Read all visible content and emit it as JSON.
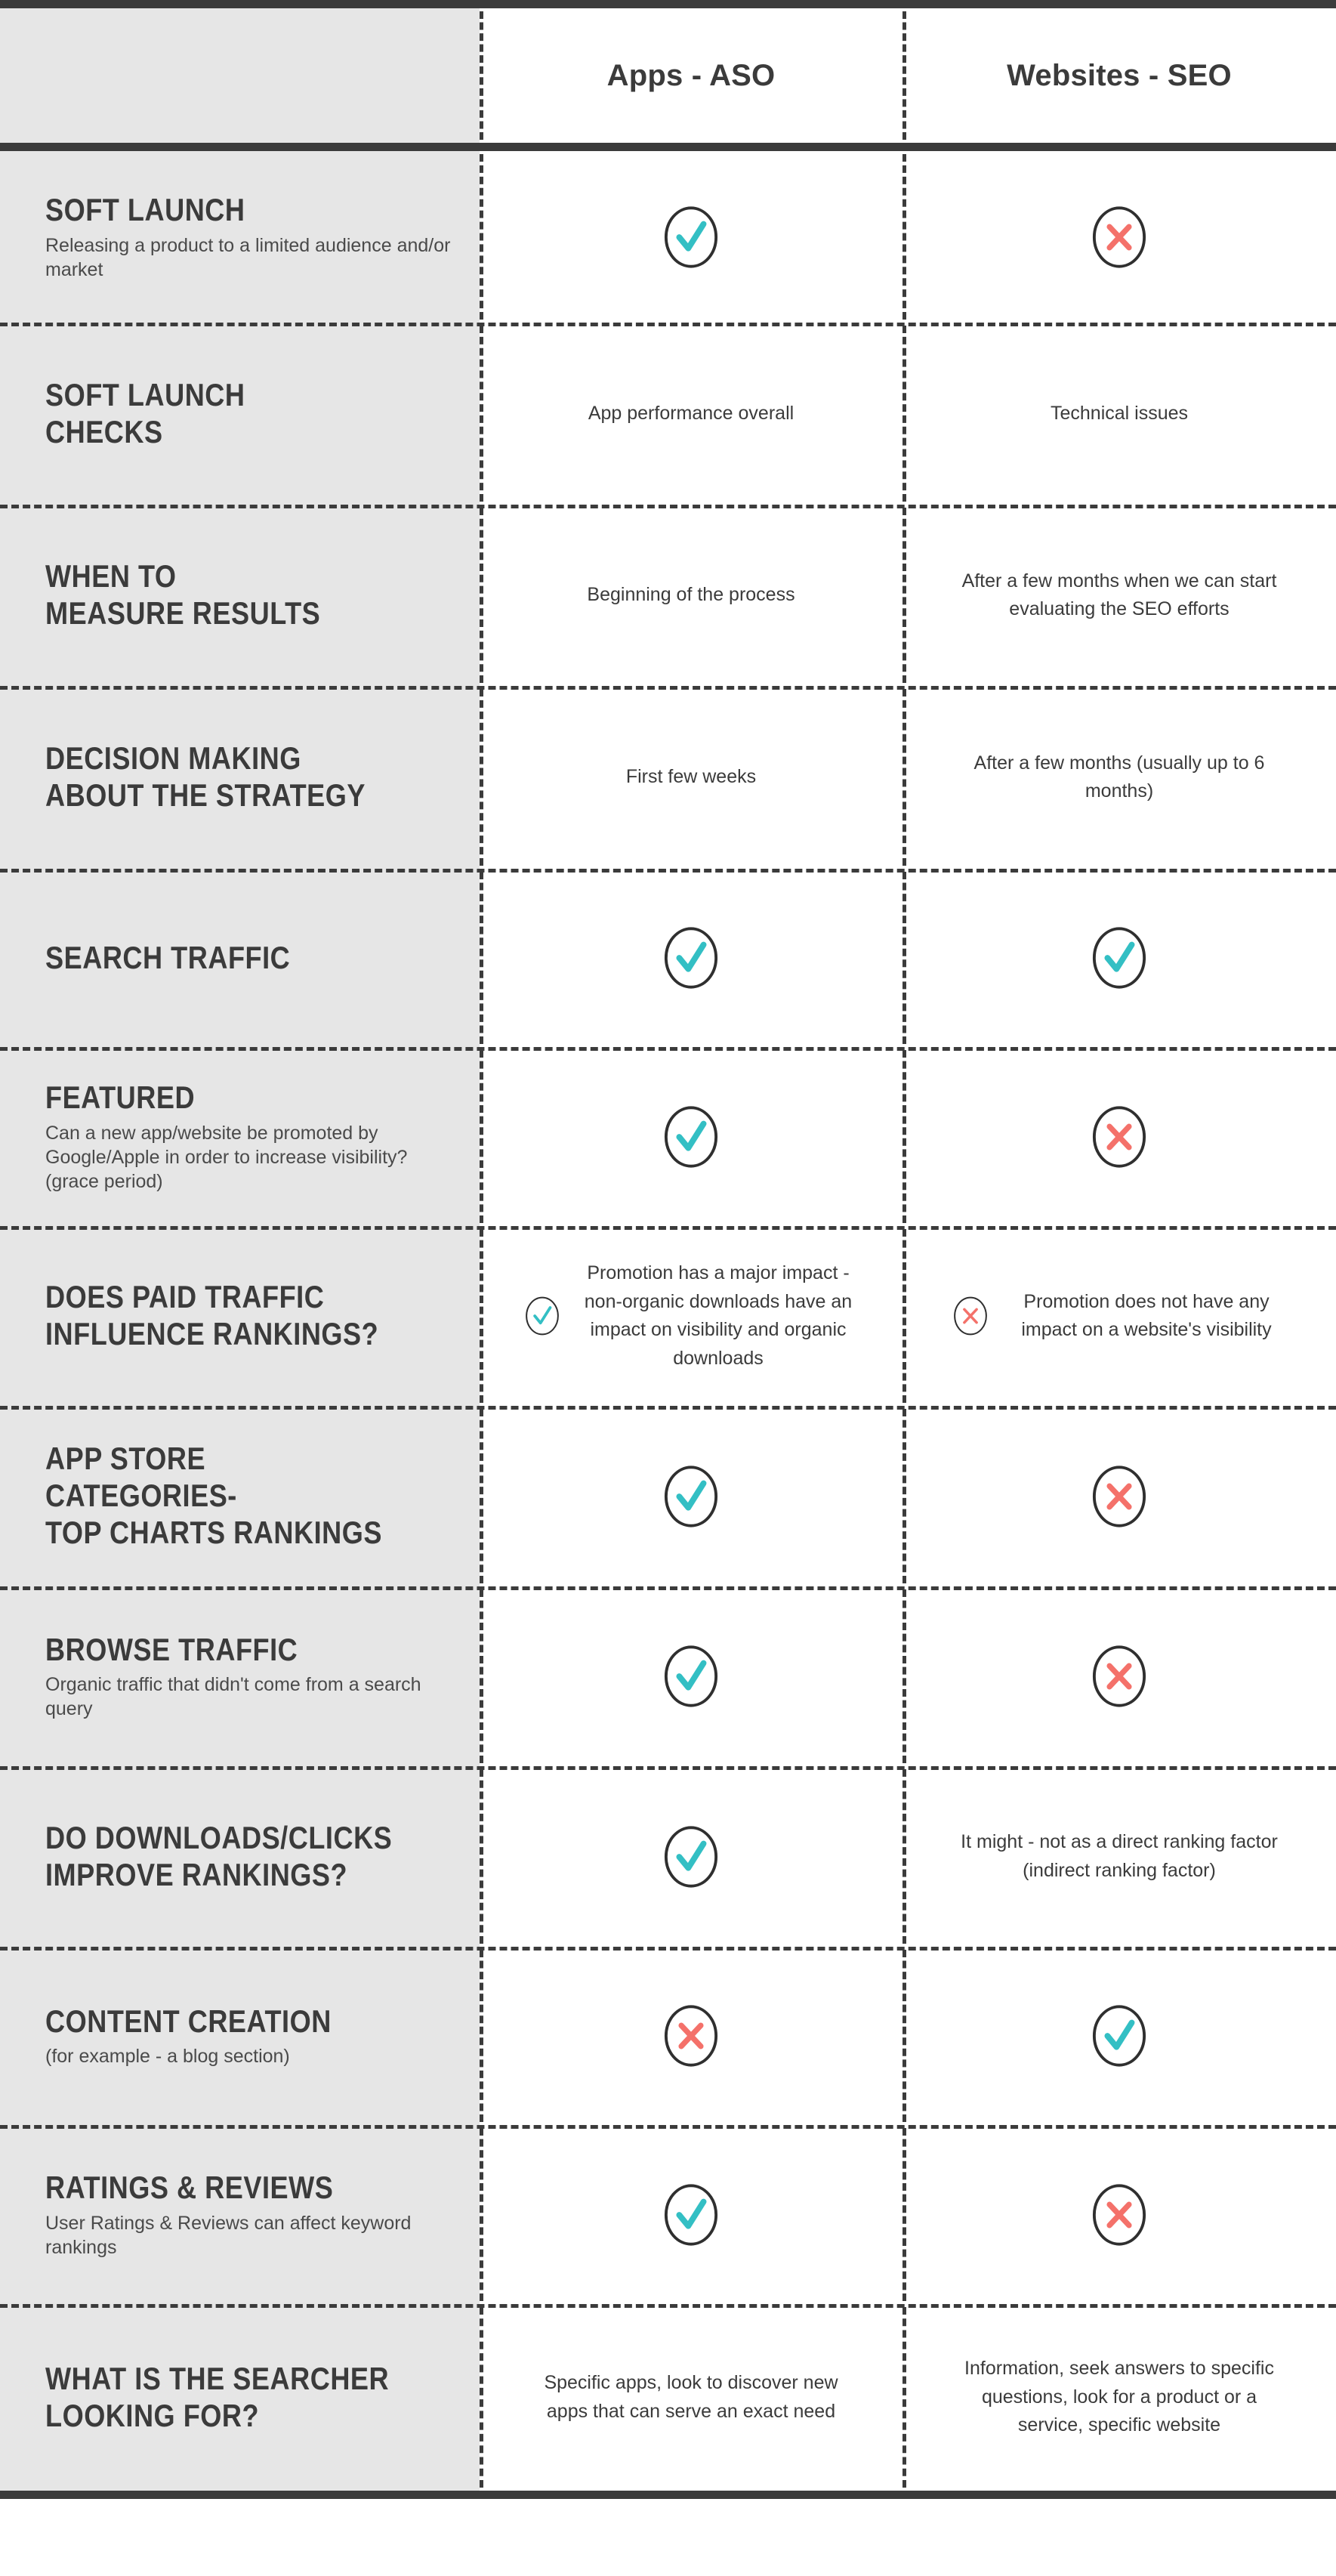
{
  "colors": {
    "check": "#33bfc4",
    "cross": "#f4716a",
    "rule": "#3b3b3b",
    "label_background": "#e6e6e6",
    "value_background": "#ffffff",
    "text": "#3b3b3b"
  },
  "header": {
    "label_column": "",
    "columns": [
      {
        "label": "Apps - ASO"
      },
      {
        "label": "Websites - SEO"
      }
    ]
  },
  "rows": [
    {
      "title": "SOFT LAUNCH",
      "subtitle": "Releasing a product to a limited audience and/or market",
      "apps": {
        "type": "check",
        "icon": "check-circle-icon",
        "text": ""
      },
      "websites": {
        "type": "cross",
        "icon": "cross-circle-icon",
        "text": ""
      }
    },
    {
      "title": "SOFT LAUNCH\nCHECKS",
      "subtitle": "",
      "apps": {
        "type": "text",
        "icon": "",
        "text": "App performance overall"
      },
      "websites": {
        "type": "text",
        "icon": "",
        "text": "Technical issues"
      }
    },
    {
      "title": "WHEN TO\nMEASURE RESULTS",
      "subtitle": "",
      "apps": {
        "type": "text",
        "icon": "",
        "text": "Beginning of the process"
      },
      "websites": {
        "type": "text",
        "icon": "",
        "text": "After a few months when we can start evaluating the SEO efforts"
      }
    },
    {
      "title": "DECISION MAKING\nABOUT THE STRATEGY",
      "subtitle": "",
      "apps": {
        "type": "text",
        "icon": "",
        "text": "First few weeks"
      },
      "websites": {
        "type": "text",
        "icon": "",
        "text": "After a few months\n(usually up to 6 months)"
      }
    },
    {
      "title": "SEARCH TRAFFIC",
      "subtitle": "",
      "apps": {
        "type": "check",
        "icon": "check-circle-icon",
        "text": ""
      },
      "websites": {
        "type": "check",
        "icon": "check-circle-icon",
        "text": ""
      }
    },
    {
      "title": "FEATURED",
      "subtitle": "Can a new app/website be promoted by Google/Apple in order to increase visibility? (grace period)",
      "apps": {
        "type": "check",
        "icon": "check-circle-icon",
        "text": ""
      },
      "websites": {
        "type": "cross",
        "icon": "cross-circle-icon",
        "text": ""
      }
    },
    {
      "title": "DOES PAID TRAFFIC\nINFLUENCE RANKINGS?",
      "subtitle": "",
      "apps": {
        "type": "check-text",
        "icon": "check-circle-icon",
        "text": "Promotion has a major impact - non-organic downloads have an impact on visibility and organic downloads"
      },
      "websites": {
        "type": "cross-text",
        "icon": "cross-circle-icon",
        "text": "Promotion does not have any impact on a website's visibility"
      }
    },
    {
      "title": "APP STORE CATEGORIES-\nTOP CHARTS RANKINGS",
      "subtitle": "",
      "apps": {
        "type": "check",
        "icon": "check-circle-icon",
        "text": ""
      },
      "websites": {
        "type": "cross",
        "icon": "cross-circle-icon",
        "text": ""
      }
    },
    {
      "title": "BROWSE TRAFFIC",
      "subtitle": "Organic traffic that didn't come from a search query",
      "apps": {
        "type": "check",
        "icon": "check-circle-icon",
        "text": ""
      },
      "websites": {
        "type": "cross",
        "icon": "cross-circle-icon",
        "text": ""
      }
    },
    {
      "title": "DO DOWNLOADS/CLICKS\nIMPROVE RANKINGS?",
      "subtitle": "",
      "apps": {
        "type": "check",
        "icon": "check-circle-icon",
        "text": ""
      },
      "websites": {
        "type": "text",
        "icon": "",
        "text": "It might - not as a direct ranking factor (indirect ranking factor)"
      }
    },
    {
      "title": "CONTENT CREATION",
      "subtitle": "(for example - a blog section)",
      "apps": {
        "type": "cross",
        "icon": "cross-circle-icon",
        "text": ""
      },
      "websites": {
        "type": "check",
        "icon": "check-circle-icon",
        "text": ""
      }
    },
    {
      "title": "RATINGS & REVIEWS",
      "subtitle": "User Ratings & Reviews can affect keyword rankings",
      "apps": {
        "type": "check",
        "icon": "check-circle-icon",
        "text": ""
      },
      "websites": {
        "type": "cross",
        "icon": "cross-circle-icon",
        "text": ""
      }
    },
    {
      "title": "WHAT IS THE SEARCHER\nLOOKING FOR?",
      "subtitle": "",
      "apps": {
        "type": "text",
        "icon": "",
        "text": "Specific apps, look to discover new apps that can serve an exact need"
      },
      "websites": {
        "type": "text",
        "icon": "",
        "text": "Information, seek answers to specific questions, look for a product or a service, specific website"
      }
    }
  ]
}
